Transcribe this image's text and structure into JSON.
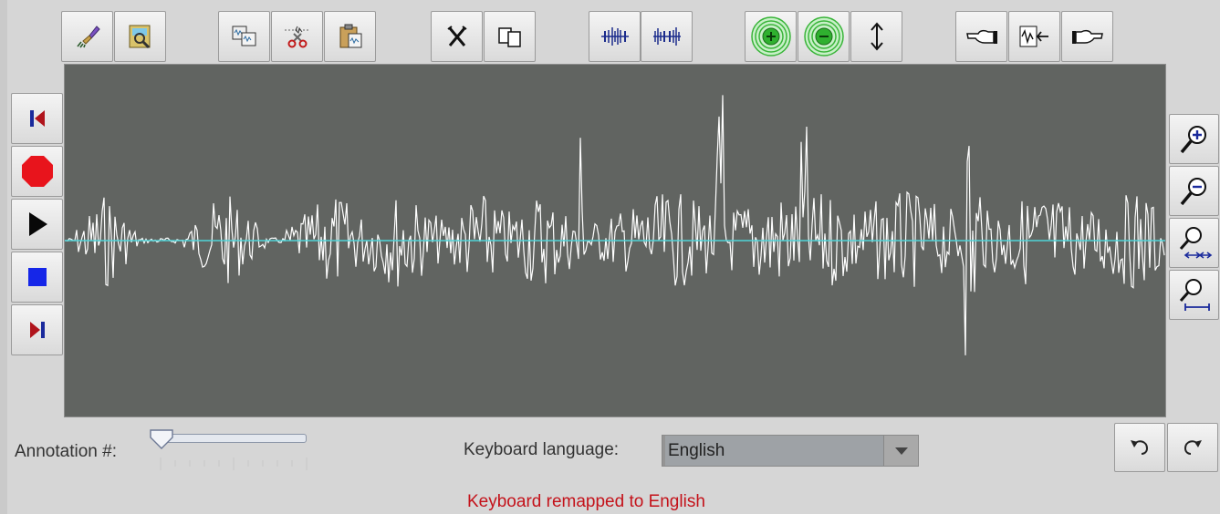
{
  "toolbar": {
    "groups": [
      [
        "erase-icon",
        "open-audio-file-icon"
      ],
      [
        "copy-icon",
        "cut-icon",
        "paste-icon"
      ],
      [
        "cross-delete-icon",
        "duplicate-icon"
      ],
      [
        "compress-wave-icon",
        "expand-wave-icon"
      ],
      [
        "increase-gain-icon",
        "decrease-gain-icon",
        "vertical-arrows-icon"
      ],
      [
        "point-left-icon",
        "waveform-marker-icon",
        "point-right-icon"
      ]
    ]
  },
  "transport": [
    "skip-to-start-icon",
    "record-icon",
    "play-icon",
    "stop-icon",
    "skip-to-end-icon"
  ],
  "zoom": [
    "zoom-in-icon",
    "zoom-out-icon",
    "zoom-horizontal-icon",
    "zoom-fit-icon"
  ],
  "annotation": {
    "label": "Annotation #:",
    "value": 0
  },
  "keyboard": {
    "label": "Keyboard language:",
    "selected": "English"
  },
  "status": {
    "message": "Keyboard remapped to English"
  },
  "colors": {
    "wave_background": "#616461",
    "waveform": "#ffffff",
    "baseline": "#4fd3d7",
    "status_text": "#c4121a",
    "record": "#e8141c",
    "stop": "#1526e8"
  }
}
